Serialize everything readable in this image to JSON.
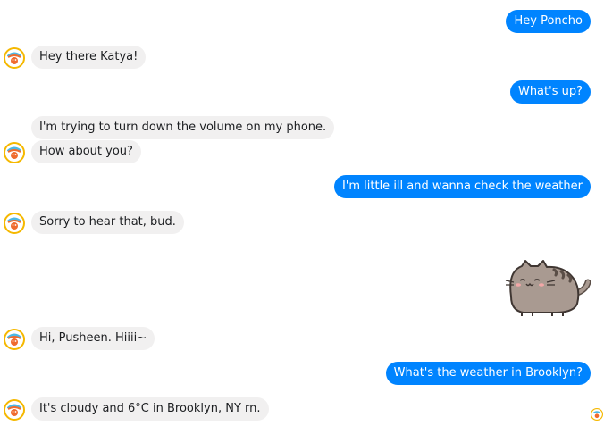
{
  "conversation": {
    "messages": [
      {
        "sender": "user",
        "text": "Hey Poncho"
      },
      {
        "sender": "bot",
        "text": "Hey there Katya!"
      },
      {
        "sender": "user",
        "text": "What's up?"
      },
      {
        "sender": "bot",
        "text": "I'm trying to turn down the volume on my phone."
      },
      {
        "sender": "bot",
        "text": "How about you?"
      },
      {
        "sender": "user",
        "text": "I'm little ill and wanna check the weather"
      },
      {
        "sender": "bot",
        "text": "Sorry to hear that, bud."
      },
      {
        "sender": "user",
        "sticker": "pusheen-cat-sticker"
      },
      {
        "sender": "bot",
        "text": "Hi, Pusheen. Hiiii~"
      },
      {
        "sender": "user",
        "text": "What's the weather in Brooklyn?"
      },
      {
        "sender": "bot",
        "text": "It's cloudy and 6°C in Brooklyn, NY rn."
      }
    ]
  },
  "icons": {
    "bot_avatar": "poncho-avatar-icon",
    "read_receipt": "poncho-read-receipt-icon",
    "sticker": "pusheen-cat-sticker"
  },
  "colors": {
    "outgoing_bubble": "#0084ff",
    "incoming_bubble": "#f1f0f0",
    "outgoing_text": "#ffffff",
    "incoming_text": "#1c1e21"
  }
}
